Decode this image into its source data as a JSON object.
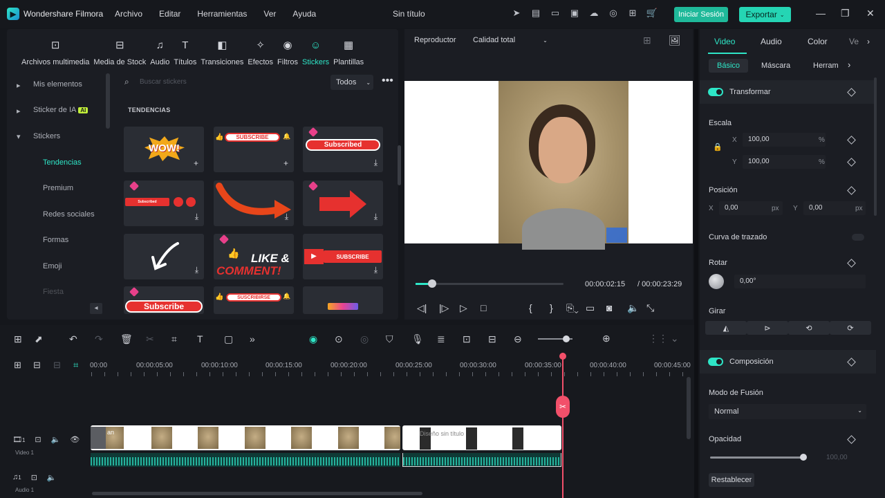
{
  "app": {
    "name": "Wondershare Filmora",
    "doc_title": "Sin título"
  },
  "menu": [
    "Archivo",
    "Editar",
    "Herramientas",
    "Ver",
    "Ayuda"
  ],
  "header": {
    "login_label": "Iniciar Sesión",
    "export_label": "Exportar"
  },
  "toolbar": {
    "tools": [
      {
        "label": "Archivos multimedia",
        "icon": "media-icon"
      },
      {
        "label": "Media de Stock",
        "icon": "stock-icon"
      },
      {
        "label": "Audio",
        "icon": "music-icon"
      },
      {
        "label": "Títulos",
        "icon": "text-icon"
      },
      {
        "label": "Transiciones",
        "icon": "transition-icon"
      },
      {
        "label": "Efectos",
        "icon": "effects-icon"
      },
      {
        "label": "Filtros",
        "icon": "filter-icon"
      },
      {
        "label": "Stickers",
        "icon": "sticker-icon"
      },
      {
        "label": "Plantillas",
        "icon": "template-icon"
      }
    ]
  },
  "sidebar": {
    "items": [
      {
        "label": "Mis elementos"
      },
      {
        "label": "Sticker de IA",
        "badge": "AI"
      },
      {
        "label": "Stickers"
      },
      {
        "label": "Tendencias"
      },
      {
        "label": "Premium"
      },
      {
        "label": "Redes sociales"
      },
      {
        "label": "Formas"
      },
      {
        "label": "Emoji"
      },
      {
        "label": "Fiesta"
      }
    ]
  },
  "stickers": {
    "search_placeholder": "Buscar stickers",
    "filter_label": "Todos",
    "section_title": "TENDENCIAS",
    "tile_text": {
      "wow": "WOW!",
      "subscribe1": "SUBSCRIBE",
      "subscribed": "Subscribed",
      "subscribed_small": "Subscribed",
      "like": "LIKE &",
      "comment": "COMMENT!",
      "subscribe_yt": "SUBSCRIBE",
      "subscribe_red": "Subscribe",
      "suscribirse": "SUSCRIBIRSE"
    }
  },
  "preview": {
    "player_label": "Reproductor",
    "quality_label": "Calidad total",
    "current_time": "00:00:02:15",
    "total_time": "/ 00:00:23:29",
    "progress": 0.11
  },
  "inspector": {
    "tabs": [
      "Video",
      "Audio",
      "Color",
      "Ve"
    ],
    "subtabs": [
      "Básico",
      "Máscara",
      "Herram"
    ],
    "transform_label": "Transformar",
    "scale_label": "Escala",
    "scale_x": "100,00",
    "scale_y": "100,00",
    "scale_unit": "%",
    "position_label": "Posición",
    "pos_x": "0,00",
    "pos_y": "0,00",
    "pos_unit": "px",
    "axis_x": "X",
    "axis_y": "Y",
    "curve_label": "Curva de trazado",
    "rotate_label": "Rotar",
    "rotate_value": "0,00°",
    "flip_label": "Girar",
    "composition_label": "Composición",
    "blend_label": "Modo de Fusión",
    "blend_value": "Normal",
    "opacity_label": "Opacidad",
    "opacity_value": "100,00",
    "reset_label": "Restablecer"
  },
  "timeline": {
    "ruler": [
      "00:00",
      "00:00:05:00",
      "00:00:10:00",
      "00:00:15:00",
      "00:00:20:00",
      "00:00:25:00",
      "00:00:30:00",
      "00:00:35:00",
      "00:00:40:00",
      "00:00:45:00"
    ],
    "video_track_label": "Video 1",
    "audio_track_label": "Audio 1",
    "track_number": "1",
    "clip1_label": "an",
    "clip2_label": "Diseño sin título"
  },
  "colors": {
    "accent": "#2ee6c7",
    "playhead": "#f2506a",
    "export": "#25d5b4"
  }
}
